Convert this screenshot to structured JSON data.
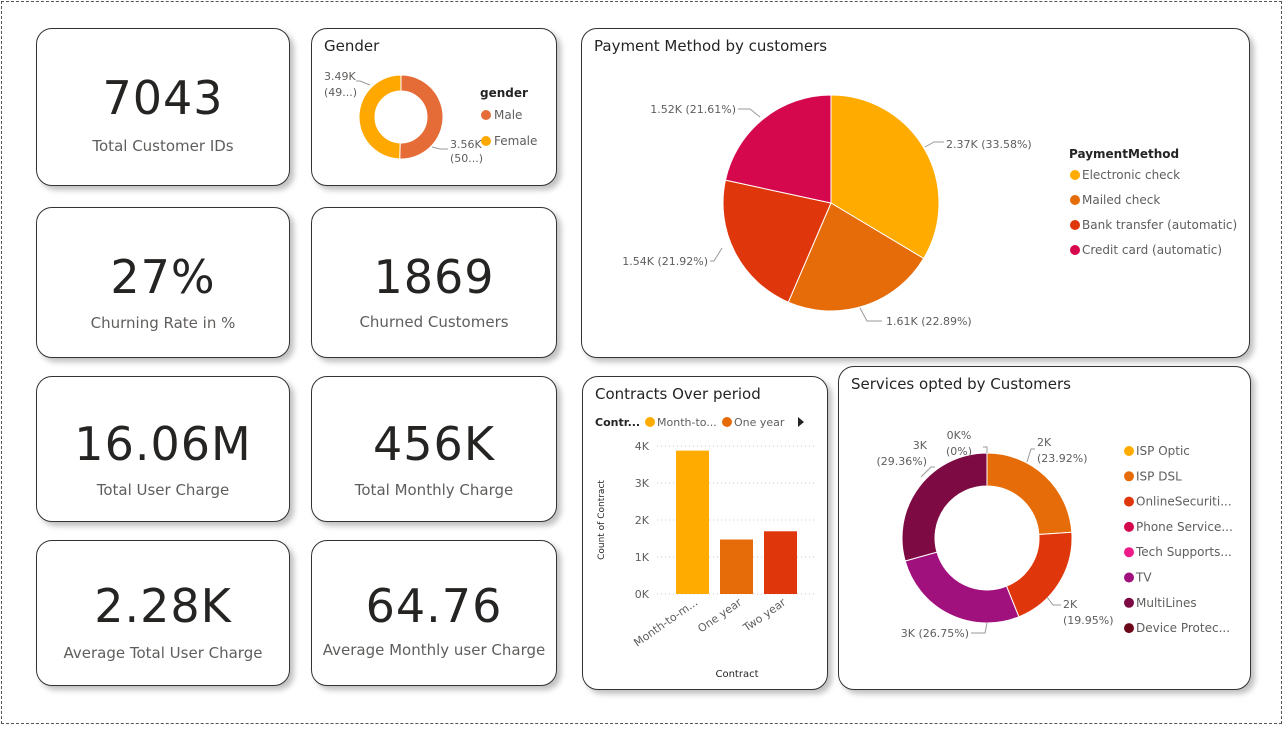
{
  "kpis": {
    "total_customers": {
      "value": "7043",
      "label": "Total Customer IDs"
    },
    "churn_rate": {
      "value": "27%",
      "label": "Churning Rate in %"
    },
    "churned": {
      "value": "1869",
      "label": "Churned Customers"
    },
    "total_user_charge": {
      "value": "16.06M",
      "label": "Total User Charge"
    },
    "total_monthly_charge": {
      "value": "456K",
      "label": "Total Monthly Charge"
    },
    "avg_total_charge": {
      "value": "2.28K",
      "label": "Average Total User Charge"
    },
    "avg_monthly_charge": {
      "value": "64.76",
      "label": "Average Monthly user Charge"
    }
  },
  "chart_data": [
    {
      "type": "pie",
      "title": "Gender",
      "legend_title": "gender",
      "donut": true,
      "legend_position": "right",
      "slices": [
        {
          "name": "Male",
          "value": 3.56,
          "label": "3.56K",
          "pct": "(50...)",
          "color": "#E66C37"
        },
        {
          "name": "Female",
          "value": 3.49,
          "label": "3.49K",
          "pct": "(49...)",
          "color": "#FFA800"
        }
      ]
    },
    {
      "type": "pie",
      "title": "Payment Method by customers",
      "legend_title": "PaymentMethod",
      "legend_position": "right",
      "slices": [
        {
          "name": "Electronic check",
          "value": 33.58,
          "label": "2.37K (33.58%)",
          "color": "#FFAB00"
        },
        {
          "name": "Mailed check",
          "value": 22.89,
          "label": "1.61K (22.89%)",
          "color": "#E66C0A"
        },
        {
          "name": "Bank transfer (automatic)",
          "value": 21.92,
          "label": "1.54K (21.92%)",
          "color": "#E0360B"
        },
        {
          "name": "Credit card (automatic)",
          "value": 21.61,
          "label": "1.52K (21.61%)",
          "color": "#D5084E"
        }
      ]
    },
    {
      "type": "bar",
      "title": "Contracts Over period",
      "legend_title": "Contr...",
      "legend_items": [
        {
          "name": "Month-to...",
          "color": "#FFAB00"
        },
        {
          "name": "One year",
          "color": "#E66C0A"
        }
      ],
      "xlabel": "Contract",
      "ylabel": "Count of Contract",
      "categories": [
        "Month-to-m...",
        "One year",
        "Two year"
      ],
      "values": [
        3875,
        1473,
        1695
      ],
      "colors": [
        "#FFAB00",
        "#E66C0A",
        "#E0360B"
      ],
      "yticks": [
        "0K",
        "1K",
        "2K",
        "3K",
        "4K"
      ],
      "ylim": [
        0,
        4000
      ]
    },
    {
      "type": "pie",
      "title": "Services opted by Customers",
      "donut": true,
      "legend_position": "right",
      "legend": [
        {
          "name": "ISP Optic",
          "color": "#FFAB00"
        },
        {
          "name": "ISP DSL",
          "color": "#E66C0A"
        },
        {
          "name": "OnlineSecuriti...",
          "color": "#E0360B"
        },
        {
          "name": "Phone Service...",
          "color": "#D5084E"
        },
        {
          "name": "Tech Supports...",
          "color": "#EE1A8A"
        },
        {
          "name": "TV",
          "color": "#A0117E"
        },
        {
          "name": "MultiLines",
          "color": "#7E0A44"
        },
        {
          "name": "Device Protec...",
          "color": "#6B0718"
        }
      ],
      "slices": [
        {
          "value": 0.001,
          "label": "0K%",
          "pct": "(0%)",
          "color": "#FFAB00"
        },
        {
          "value": 23.92,
          "label": "2K",
          "pct": "(23.92%)",
          "color": "#E66C0A"
        },
        {
          "value": 19.95,
          "label": "2K",
          "pct": "(19.95%)",
          "color": "#E0360B"
        },
        {
          "value": 26.75,
          "label": "3K (26.75%)",
          "pct": "",
          "color": "#A0117E"
        },
        {
          "value": 29.36,
          "label": "3K",
          "pct": "(29.36%)",
          "color": "#7E0A44"
        }
      ]
    }
  ]
}
